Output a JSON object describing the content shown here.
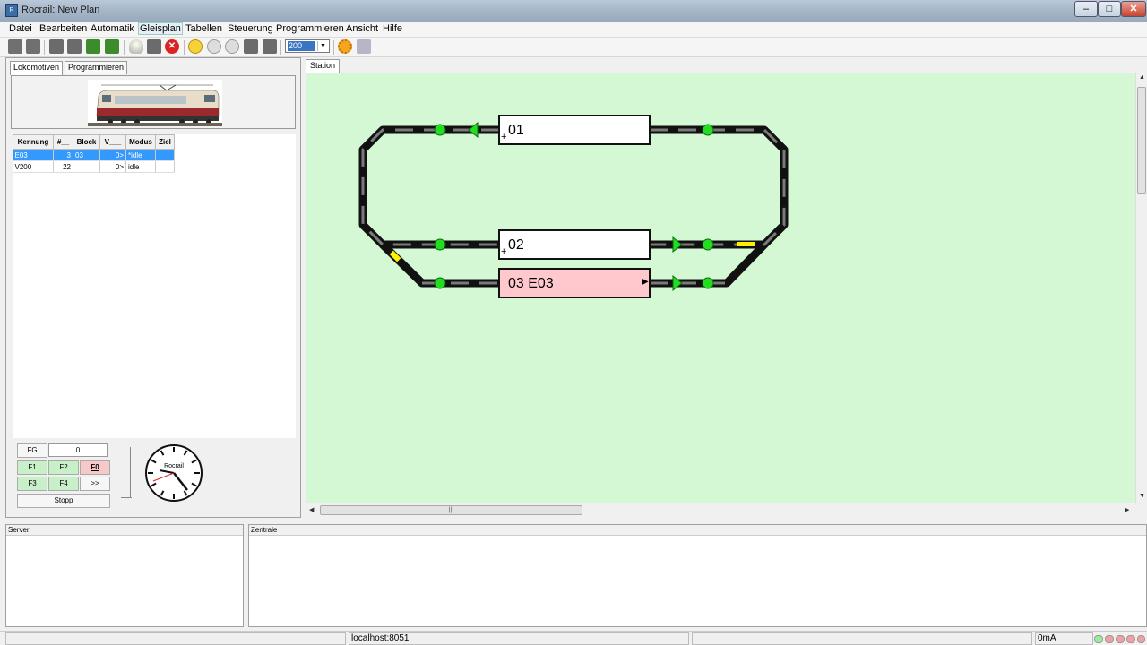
{
  "window": {
    "title": "Rocrail: New Plan",
    "min": "–",
    "max": "□",
    "close": "✕"
  },
  "menu": [
    "Datei",
    "Bearbeiten",
    "Automatik",
    "Gleisplan",
    "Tabellen",
    "Steuerung",
    "Programmieren",
    "Ansicht",
    "Hilfe"
  ],
  "toolbar": {
    "icons": [
      "open-folder-icon",
      "save-icon",
      "new-doc-icon",
      "import-icon",
      "upload-icon",
      "undo-icon",
      "bulb-icon",
      "loco-icon",
      "stop-icon",
      "smiley-icon",
      "face-icon",
      "cloud-icon",
      "grid-icon",
      "switch-icon",
      "gear-icon",
      "book-icon"
    ],
    "zoom": "200"
  },
  "left": {
    "tabs": [
      "Lokomotiven",
      "Programmieren"
    ],
    "table": {
      "headers": [
        "Kennung",
        "#__",
        "Block",
        "V___",
        "Modus",
        "Ziel"
      ],
      "rows": [
        [
          "E03",
          "3",
          "03",
          "0>",
          "*idle",
          ""
        ],
        [
          "V200",
          "22",
          "",
          "0>",
          "idle",
          ""
        ]
      ]
    },
    "functions": {
      "fg": "FG",
      "value": "0",
      "f1": "F1",
      "f2": "F2",
      "f0": "F0",
      "f3": "F3",
      "f4": "F4",
      "more": ">>",
      "stop": "Stopp"
    },
    "clock_label": "Rocrail"
  },
  "plan": {
    "tab": "Station",
    "blocks": [
      {
        "label": "01",
        "occupied": false
      },
      {
        "label": "02",
        "occupied": false
      },
      {
        "label": "03 E03",
        "occupied": true
      }
    ],
    "colors": {
      "background": "#d4f8d4",
      "track": "#111111",
      "signal_green": "#22dd22",
      "occupied": "#ffc8cc",
      "yellow": "#ffee00"
    }
  },
  "bottom": {
    "server": "Server",
    "central": "Zentrale"
  },
  "status": {
    "host": "localhost:8051",
    "current": "0mA"
  }
}
